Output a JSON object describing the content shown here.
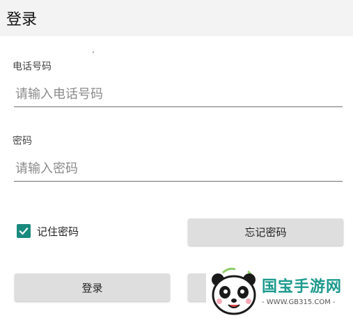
{
  "appbar": {
    "title": "登录"
  },
  "phone": {
    "label": "电话号码",
    "placeholder": "请输入电话号码",
    "value": ""
  },
  "password": {
    "label": "密码",
    "placeholder": "请输入密码",
    "value": ""
  },
  "remember": {
    "label": "记住密码",
    "checked": true
  },
  "buttons": {
    "forgot": "忘记密码",
    "login": "登录",
    "register": ""
  },
  "watermark": {
    "brand": "国宝手游网",
    "url": "- WWW.GB315.COM -"
  },
  "colors": {
    "accent": "#1a8a7e",
    "appbar_bg": "#f3f3f3",
    "button_bg": "#dedede"
  },
  "icons": {
    "checkbox": "checkmark-icon",
    "watermark_logo": "panda-logo-icon"
  }
}
